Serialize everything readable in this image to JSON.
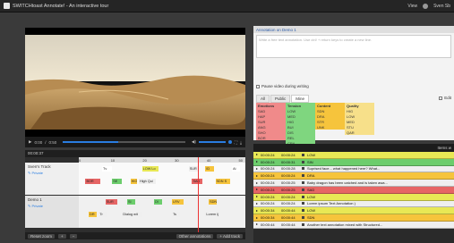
{
  "app": {
    "title": "SWITCHtoast Annotate! - An interactive tour",
    "menu": [
      "View",
      "Sven Sb"
    ]
  },
  "video": {
    "current_time": "0:00",
    "duration": "0:50",
    "progress": 0.45
  },
  "timeline": {
    "time": "00:00:37",
    "ruler_ticks": [
      "0",
      "10",
      "20",
      "30",
      "40",
      "50"
    ],
    "tracks": [
      {
        "name": "Sven's Track",
        "privacy": "Private",
        "segments": [
          {
            "label": "Tv",
            "color": "#ffffff",
            "row": 0,
            "start": 0.14,
            "width": 0.06
          },
          {
            "label": "HAP",
            "color": "#f6c43c",
            "row": 0,
            "start": 0.4,
            "width": 0.05
          },
          {
            "label": "LOW Lo",
            "color": "#e8e855",
            "row": 0,
            "start": 0.38,
            "width": 0.1
          },
          {
            "label": "SUR",
            "color": "#efefef",
            "row": 0,
            "start": 0.66,
            "width": 0.06
          },
          {
            "label": "ID",
            "color": "#f6c43c",
            "row": 0,
            "start": 0.76,
            "width": 0.05
          },
          {
            "label": "Ai",
            "color": "#ffffff",
            "row": 0,
            "start": 0.92,
            "width": 0.05
          },
          {
            "label": "BOR",
            "color": "#e66565",
            "row": 1,
            "start": 0.04,
            "width": 0.09
          },
          {
            "label": "SE",
            "color": "#6ccd6c",
            "row": 1,
            "start": 0.2,
            "width": 0.06
          },
          {
            "label": "HIG",
            "color": "#f6c43c",
            "row": 1,
            "start": 0.31,
            "width": 0.04
          },
          {
            "label": "High Qui",
            "color": "#efefef",
            "row": 1,
            "start": 0.36,
            "width": 0.1
          },
          {
            "label": "SAD",
            "color": "#e66565",
            "row": 1,
            "start": 0.68,
            "width": 0.06
          },
          {
            "label": "SDN S",
            "color": "#f6c43c",
            "row": 1,
            "start": 0.82,
            "width": 0.09
          }
        ]
      },
      {
        "name": "Demo 1",
        "privacy": "Private",
        "segments": [
          {
            "label": "SUR",
            "color": "#e66565",
            "row": 0,
            "start": 0.16,
            "width": 0.07
          },
          {
            "label": "SI",
            "color": "#6ccd6c",
            "row": 0,
            "start": 0.29,
            "width": 0.05
          },
          {
            "label": "OI",
            "color": "#6ccd6c",
            "row": 0,
            "start": 0.45,
            "width": 0.05
          },
          {
            "label": "LRV",
            "color": "#f6c43c",
            "row": 0,
            "start": 0.56,
            "width": 0.07
          },
          {
            "label": "SDN",
            "color": "#f6c43c",
            "row": 0,
            "start": 0.78,
            "width": 0.05
          },
          {
            "label": "DR",
            "color": "#f6c43c",
            "row": 1,
            "start": 0.06,
            "width": 0.05
          },
          {
            "label": "Tr",
            "color": "#efefef",
            "row": 1,
            "start": 0.12,
            "width": 0.05
          },
          {
            "label": "Dialog wit",
            "color": "#efefef",
            "row": 1,
            "start": 0.26,
            "width": 0.12
          },
          {
            "label": "Ts",
            "color": "#efefef",
            "row": 1,
            "start": 0.56,
            "width": 0.05
          },
          {
            "label": "Lorem ij",
            "color": "#efefef",
            "row": 1,
            "start": 0.76,
            "width": 0.09
          }
        ]
      }
    ],
    "footer": {
      "reset_zoom": "Reset zoom",
      "other": "Other annotations",
      "add_track": "+ Add track"
    }
  },
  "annotation": {
    "header": "Annotation on Demo 1",
    "placeholder": "Write a free text annotation. Use ctrl/ + return keys to create a new line.",
    "pause_label": "Pause video during writing",
    "tabs": [
      "All",
      "Public",
      "Mine"
    ],
    "edit_label": "Edit",
    "categories": [
      {
        "name": "Emotions",
        "color": "#f08a8a",
        "items": [
          "SAD",
          "HAP",
          "SUR",
          "ANG",
          "SHO",
          "BOR"
        ]
      },
      {
        "name": "Tension",
        "color": "#7fd67f",
        "items": [
          "LOW",
          "MED",
          "HIG",
          "BUI",
          "DIS",
          "REL",
          "CRA"
        ]
      },
      {
        "name": "Content",
        "color": "#f6c43c",
        "items": [
          "SDN",
          "DRA",
          "STR",
          "UNK"
        ]
      },
      {
        "name": "Quality",
        "color": "#f7e08a",
        "items": [
          "HIG",
          "LOW",
          "MED",
          "STU",
          "QAR"
        ]
      }
    ]
  },
  "annotation_list": {
    "header": "Items w",
    "rows": [
      {
        "time": "00:00:24",
        "end": "00:00:24",
        "text": "LOW",
        "color": "#e8e855"
      },
      {
        "time": "00:00:24",
        "end": "00:00:31",
        "text": "SIN",
        "color": "#6ccd6c"
      },
      {
        "time": "00:00:24",
        "end": "00:00:28",
        "text": "Suprised face... what happened here? What...",
        "color": "#efefef"
      },
      {
        "time": "00:00:24",
        "end": "00:00:24",
        "text": "DRA",
        "color": "#f6c43c"
      },
      {
        "time": "00:00:24",
        "end": "00:00:25",
        "text": "Baby dragon has been catched and is taken awa...",
        "color": "#efefef"
      },
      {
        "time": "00:00:24",
        "end": "00:00:25",
        "text": "SAD",
        "color": "#e66565"
      },
      {
        "time": "00:00:24",
        "end": "00:00:24",
        "text": "LOW",
        "color": "#e8e855"
      },
      {
        "time": "00:00:24",
        "end": "00:00:24",
        "text": "Lorem ipsum Text Annotation )",
        "color": "#efefef"
      },
      {
        "time": "00:00:34",
        "end": "00:00:44",
        "text": "LOW",
        "color": "#e8e855"
      },
      {
        "time": "00:00:34",
        "end": "00:00:44",
        "text": "SDN",
        "color": "#f6c43c"
      },
      {
        "time": "00:00:44",
        "end": "00:00:44",
        "text": "Another text annotation mixed with Structured...",
        "color": "#efefef"
      }
    ]
  }
}
